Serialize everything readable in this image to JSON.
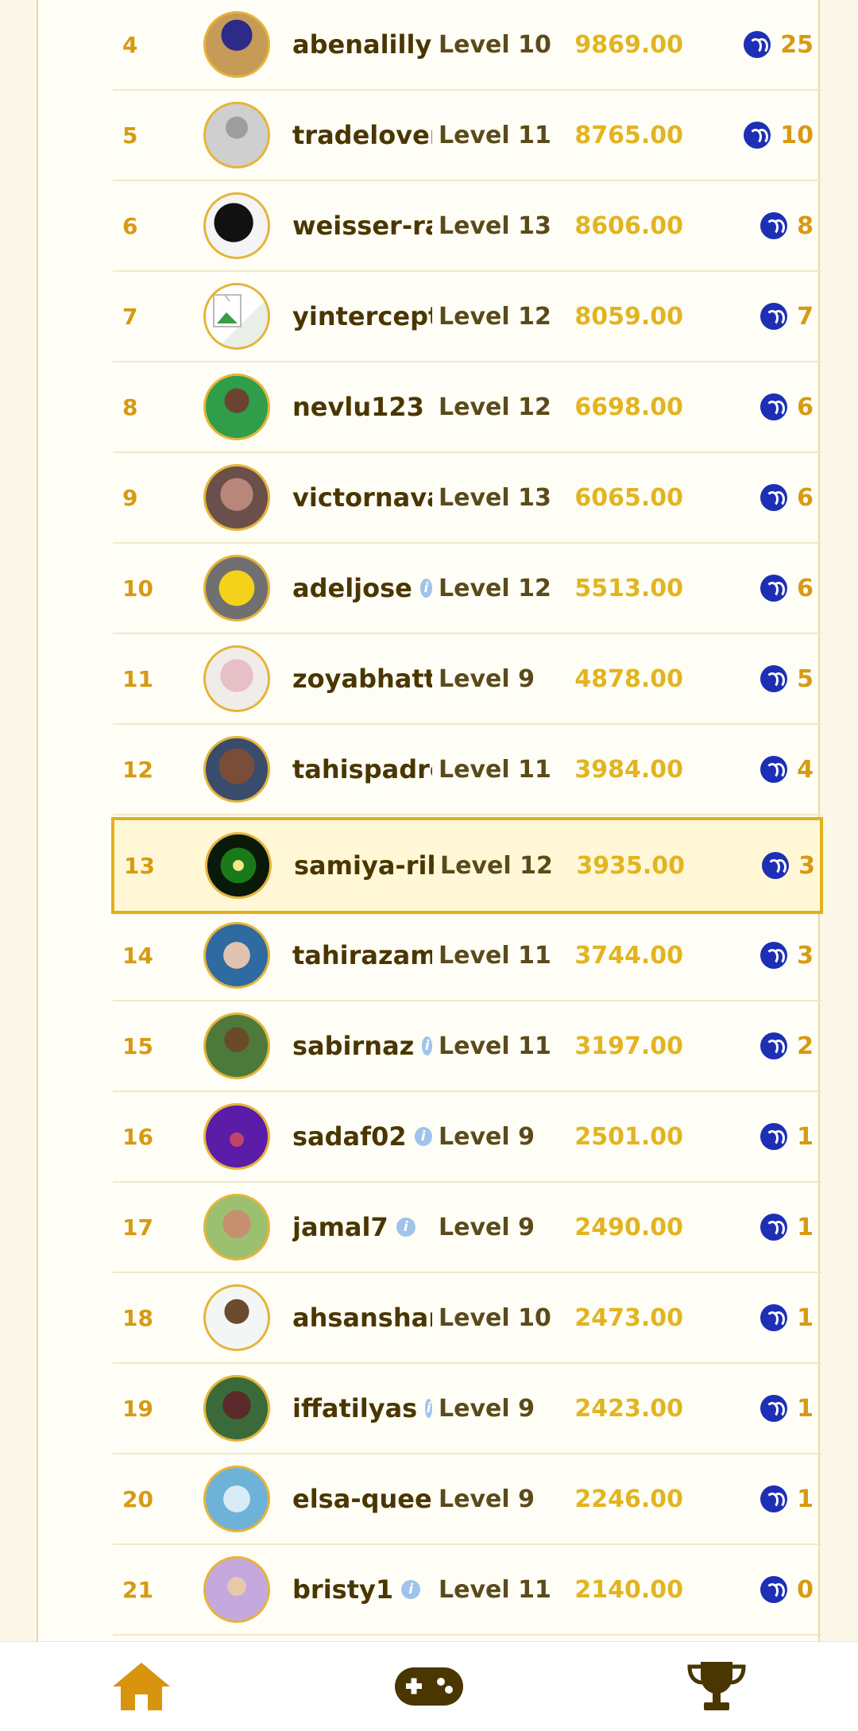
{
  "leaderboard": {
    "rows": [
      {
        "rank": "4",
        "username": "abenalillyf",
        "verified": false,
        "level": "Level 10",
        "score": "9869.00",
        "reward": "25",
        "avatar": "photo-woman-blue-dress"
      },
      {
        "rank": "5",
        "username": "tradelover",
        "verified": false,
        "level": "Level 11",
        "score": "8765.00",
        "reward": "10",
        "avatar": "default-silhouette"
      },
      {
        "rank": "6",
        "username": "weisser-ra",
        "verified": false,
        "level": "Level 13",
        "score": "8606.00",
        "reward": "8",
        "avatar": "photo-silhouette-peace"
      },
      {
        "rank": "7",
        "username": "yintercept",
        "verified": false,
        "level": "Level 12",
        "score": "8059.00",
        "reward": "7",
        "avatar": "broken-image"
      },
      {
        "rank": "8",
        "username": "nevlu123",
        "verified": true,
        "level": "Level 12",
        "score": "6698.00",
        "reward": "6",
        "avatar": "photo-man-green"
      },
      {
        "rank": "9",
        "username": "victornava",
        "verified": false,
        "level": "Level 13",
        "score": "6065.00",
        "reward": "6",
        "avatar": "photo-blurred-face"
      },
      {
        "rank": "10",
        "username": "adeljose",
        "verified": true,
        "level": "Level 12",
        "score": "5513.00",
        "reward": "6",
        "avatar": "yellow-bird-cartoon"
      },
      {
        "rank": "11",
        "username": "zoyabhatti",
        "verified": false,
        "level": "Level 9",
        "score": "4878.00",
        "reward": "5",
        "avatar": "photo-girl-pink"
      },
      {
        "rank": "12",
        "username": "tahispadro",
        "verified": false,
        "level": "Level 11",
        "score": "3984.00",
        "reward": "4",
        "avatar": "photo-child-smile"
      },
      {
        "rank": "13",
        "username": "samiya-rih",
        "verified": false,
        "level": "Level 12",
        "score": "3935.00",
        "reward": "3",
        "avatar": "green-leaves-art",
        "highlight": true
      },
      {
        "rank": "14",
        "username": "tahirazam",
        "verified": false,
        "level": "Level 11",
        "score": "3744.00",
        "reward": "3",
        "avatar": "photo-child-blue"
      },
      {
        "rank": "15",
        "username": "sabirnaz",
        "verified": true,
        "level": "Level 11",
        "score": "3197.00",
        "reward": "2",
        "avatar": "photo-boy-outdoor"
      },
      {
        "rank": "16",
        "username": "sadaf02",
        "verified": true,
        "level": "Level 9",
        "score": "2501.00",
        "reward": "1",
        "avatar": "purple-art"
      },
      {
        "rank": "17",
        "username": "jamal7",
        "verified": true,
        "level": "Level 9",
        "score": "2490.00",
        "reward": "1",
        "avatar": "photo-family"
      },
      {
        "rank": "18",
        "username": "ahsanshari",
        "verified": false,
        "level": "Level 10",
        "score": "2473.00",
        "reward": "1",
        "avatar": "photo-man-white"
      },
      {
        "rank": "19",
        "username": "iffatilyas",
        "verified": true,
        "level": "Level 9",
        "score": "2423.00",
        "reward": "1",
        "avatar": "photo-woman-garden"
      },
      {
        "rank": "20",
        "username": "elsa-queer",
        "verified": false,
        "level": "Level 9",
        "score": "2246.00",
        "reward": "1",
        "avatar": "photo-blue-toys"
      },
      {
        "rank": "21",
        "username": "bristy1",
        "verified": true,
        "level": "Level 11",
        "score": "2140.00",
        "reward": "0",
        "avatar": "photo-woman-hijab"
      }
    ]
  },
  "bottom_nav": {
    "items": [
      {
        "name": "home",
        "icon": "home-icon",
        "active": true
      },
      {
        "name": "games",
        "icon": "gamepad-icon",
        "active": false
      },
      {
        "name": "leaderboard",
        "icon": "trophy-icon",
        "active": false
      }
    ]
  },
  "colors": {
    "rank": "#d79a12",
    "username": "#4a3600",
    "score": "#e2b420",
    "steem": "#1d2fb5",
    "highlight_border": "#e4b01a",
    "nav_icon": "#d8940f"
  }
}
